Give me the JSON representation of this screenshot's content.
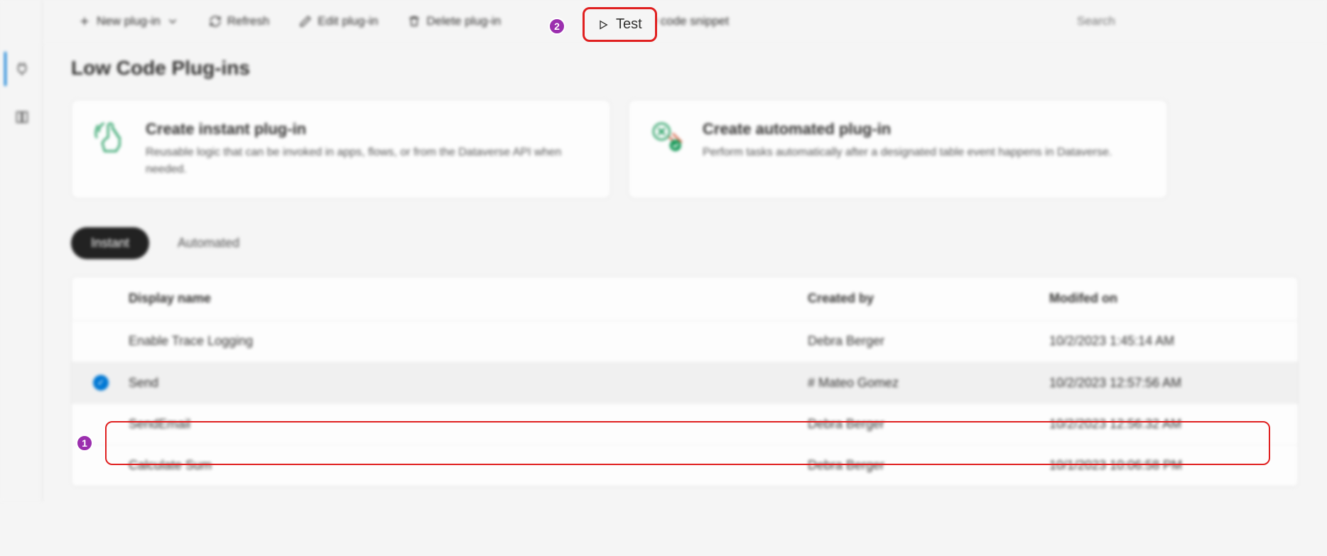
{
  "toolbar": {
    "new_plugin": "New plug-in",
    "refresh": "Refresh",
    "edit": "Edit plug-in",
    "delete": "Delete plug-in",
    "test": "Test",
    "copy": "Copy code snippet",
    "search_placeholder": "Search"
  },
  "page": {
    "title": "Low Code Plug-ins"
  },
  "cards": {
    "instant": {
      "title": "Create instant plug-in",
      "desc": "Reusable logic that can be invoked in apps, flows, or from the Dataverse API when needed."
    },
    "automated": {
      "title": "Create automated plug-in",
      "desc": "Perform tasks automatically after a designated table event happens in Dataverse."
    }
  },
  "tabs": {
    "instant": "Instant",
    "automated": "Automated"
  },
  "table": {
    "headers": {
      "display_name": "Display name",
      "created_by": "Created by",
      "modified_on": "Modifed on"
    },
    "rows": [
      {
        "name": "Enable Trace Logging",
        "created": "Debra Berger",
        "modified": "10/2/2023 1:45:14 AM",
        "selected": false
      },
      {
        "name": "Send",
        "created": "# Mateo Gomez",
        "modified": "10/2/2023 12:57:56 AM",
        "selected": true
      },
      {
        "name": "SendEmail",
        "created": "Debra Berger",
        "modified": "10/2/2023 12:56:32 AM",
        "selected": false
      },
      {
        "name": "Calculate Sum",
        "created": "Debra Berger",
        "modified": "10/1/2023 10:06:58 PM",
        "selected": false
      }
    ]
  },
  "callouts": {
    "one": "1",
    "two": "2"
  }
}
